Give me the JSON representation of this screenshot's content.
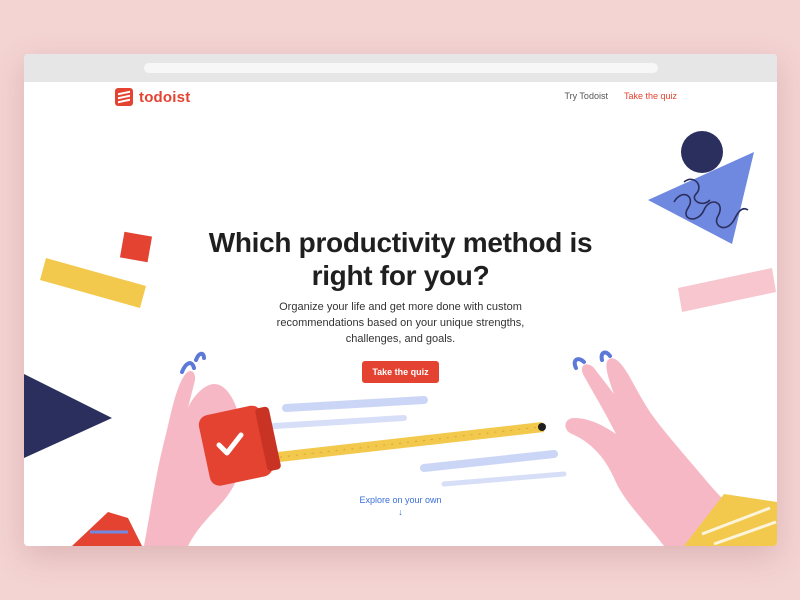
{
  "brand": {
    "name": "todoist",
    "color": "#e44332"
  },
  "nav": {
    "try_label": "Try Todoist",
    "quiz_label": "Take the quiz"
  },
  "hero": {
    "title": "Which productivity method is right for you?",
    "subtitle": "Organize your life and get more done with custom recommendations based on your unique strengths, challenges, and goals.",
    "cta_label": "Take the quiz"
  },
  "explore": {
    "label": "Explore on your own",
    "arrow": "↓"
  },
  "icons": {
    "logo": "todoist-logo-icon",
    "check": "check-icon",
    "arrow": "arrow-down-icon"
  },
  "colors": {
    "background": "#f4d3d3",
    "accent": "#e44332",
    "link": "#3a6fd8",
    "yellow": "#f2c94c",
    "navy": "#2b2f5e",
    "periwinkle": "#6f88e0",
    "pink": "#f7c6cf"
  }
}
